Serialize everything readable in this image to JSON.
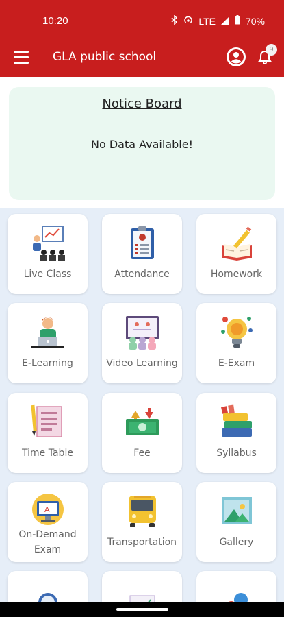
{
  "status": {
    "time": "10:20",
    "network": "LTE",
    "battery": "70%"
  },
  "appbar": {
    "title": "GLA public school",
    "notification_count": "9"
  },
  "notice": {
    "title": "Notice Board",
    "empty_text": "No Data Available!"
  },
  "tiles": [
    {
      "label": "Live Class",
      "icon": "live-class-icon"
    },
    {
      "label": "Attendance",
      "icon": "attendance-icon"
    },
    {
      "label": "Homework",
      "icon": "homework-icon"
    },
    {
      "label": "E-Learning",
      "icon": "e-learning-icon"
    },
    {
      "label": "Video Learning",
      "icon": "video-learning-icon"
    },
    {
      "label": "E-Exam",
      "icon": "e-exam-icon"
    },
    {
      "label": "Time Table",
      "icon": "time-table-icon"
    },
    {
      "label": "Fee",
      "icon": "fee-icon"
    },
    {
      "label": "Syllabus",
      "icon": "syllabus-icon"
    },
    {
      "label": "On-Demand Exam",
      "icon": "on-demand-exam-icon"
    },
    {
      "label": "Transportation",
      "icon": "transportation-icon"
    },
    {
      "label": "Gallery",
      "icon": "gallery-icon"
    }
  ],
  "colors": {
    "primary": "#c81e1e",
    "notice_bg": "#eaf8f1",
    "page_bg": "#e6eef8"
  }
}
